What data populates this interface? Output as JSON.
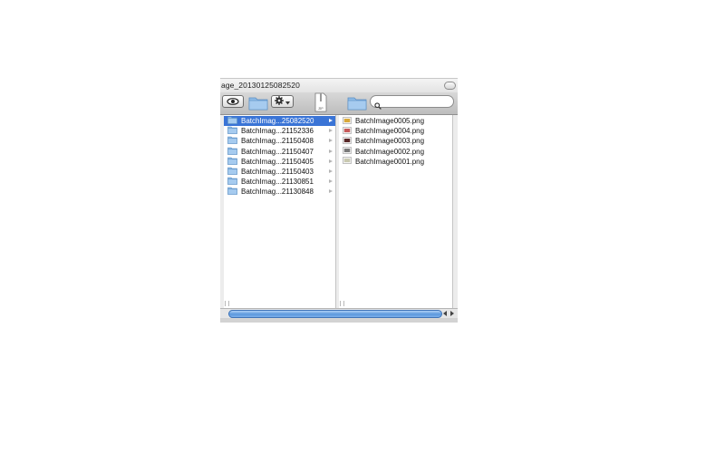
{
  "window": {
    "title": "age_20130125082520"
  },
  "toolbar": {
    "quick_look_icon": "eye-icon",
    "new_folder_icon": "folder-icon",
    "action_icon": "gear-icon",
    "zip_icon": "zip-file-icon",
    "zip_label": "ZIP",
    "path_icon": "folder-icon",
    "search": {
      "value": "",
      "placeholder": ""
    }
  },
  "columns": {
    "folders": [
      {
        "label": "BatchImag...25082520",
        "selected": true
      },
      {
        "label": "BatchImag...21152336",
        "selected": false
      },
      {
        "label": "BatchImag...21150408",
        "selected": false
      },
      {
        "label": "BatchImag...21150407",
        "selected": false
      },
      {
        "label": "BatchImag...21150405",
        "selected": false
      },
      {
        "label": "BatchImag...21150403",
        "selected": false
      },
      {
        "label": "BatchImag...21130851",
        "selected": false
      },
      {
        "label": "BatchImag...21130848",
        "selected": false
      }
    ],
    "files": [
      {
        "label": "BatchImage0005.png",
        "icon": "image-thumbnail-icon",
        "tint": "#d9a93a"
      },
      {
        "label": "BatchImage0004.png",
        "icon": "image-thumbnail-icon",
        "tint": "#c75a5a"
      },
      {
        "label": "BatchImage0003.png",
        "icon": "image-thumbnail-icon",
        "tint": "#5a2a2a"
      },
      {
        "label": "BatchImage0002.png",
        "icon": "image-thumbnail-icon",
        "tint": "#7a7a7a"
      },
      {
        "label": "BatchImage0001.png",
        "icon": "image-thumbnail-icon",
        "tint": "#c9c9b0"
      }
    ]
  },
  "colors": {
    "selection": "#3a74d6",
    "folder": "#8fbbe6",
    "scroll_thumb": "#5b98de"
  }
}
